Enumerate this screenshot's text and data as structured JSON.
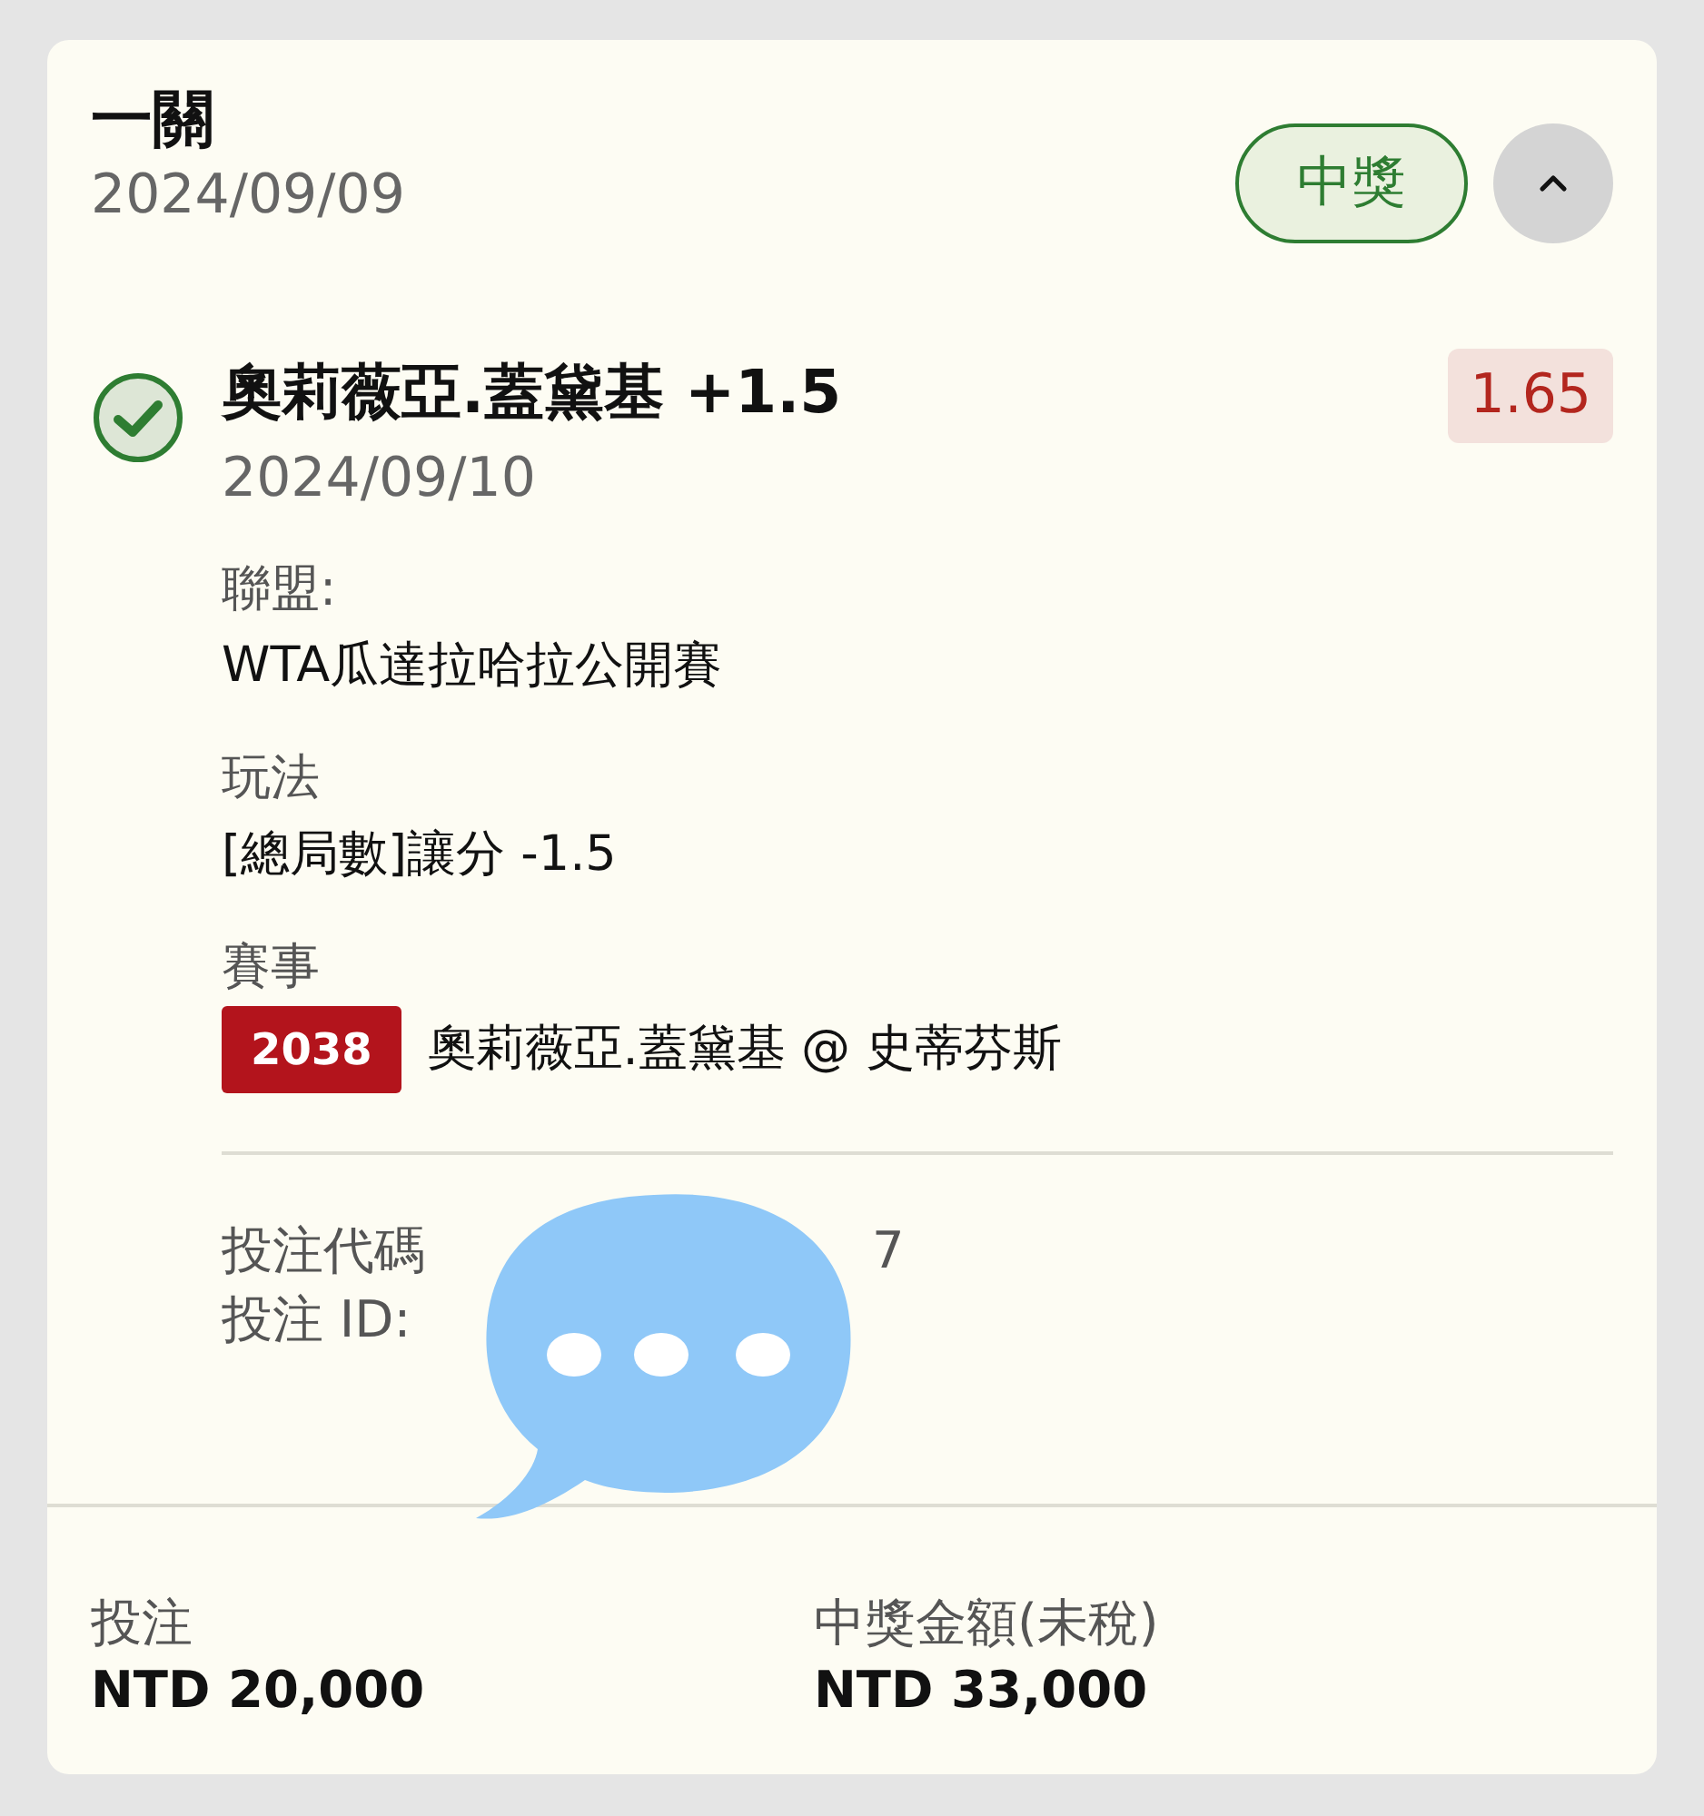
{
  "bet": {
    "type": "一關",
    "date": "2024/09/09",
    "status": "中獎",
    "expanded": true
  },
  "selection": {
    "won": true,
    "title": "奧莉薇亞.蓋黛基 +1.5",
    "date": "2024/09/10",
    "odds": "1.65",
    "details": [
      {
        "label": "聯盟:",
        "value": "WTA瓜達拉哈拉公開賽"
      },
      {
        "label": "玩法",
        "value": "[總局數]讓分 -1.5"
      },
      {
        "label": "賽事",
        "code": "2038",
        "value": "奧莉薇亞.蓋黛基 @ 史蒂芬斯"
      }
    ]
  },
  "codes": {
    "bet_code_label": "投注代碼",
    "bet_code_tail": "7",
    "bet_id_label": "投注 ID:"
  },
  "footer": [
    {
      "label": "投注",
      "value": "NTD 20,000"
    },
    {
      "label": "中獎金額(未稅)",
      "value": "NTD 33,000"
    }
  ]
}
